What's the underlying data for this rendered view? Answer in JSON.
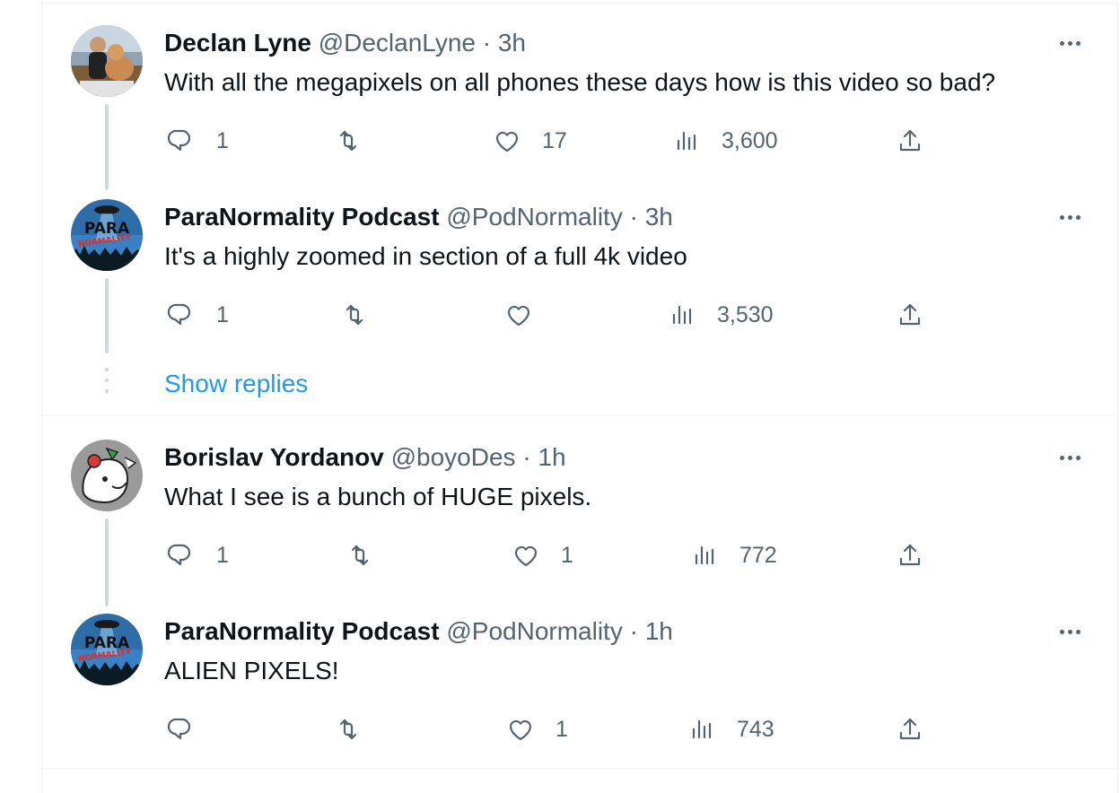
{
  "tweets": [
    {
      "name": "Declan Lyne",
      "handle": "@DeclanLyne",
      "sep": "·",
      "time": "3h",
      "text": "With all the megapixels on all phones these days how is this video so bad?",
      "replies": "1",
      "retweets": "",
      "likes": "17",
      "views": "3,600",
      "avatar": "person-with-dog-photo"
    },
    {
      "name": "ParaNormality Podcast",
      "handle": "@PodNormality",
      "sep": "·",
      "time": "3h",
      "text": "It's a highly zoomed in section of a full 4k video",
      "replies": "1",
      "retweets": "",
      "likes": "",
      "views": "3,530",
      "avatar": "paranormality-logo"
    },
    {
      "name": "Borislav Yordanov",
      "handle": "@boyoDes",
      "sep": "·",
      "time": "1h",
      "text": "What I see is a bunch of HUGE pixels.",
      "replies": "1",
      "retweets": "",
      "likes": "1",
      "views": "772",
      "avatar": "cartoon-illustration"
    },
    {
      "name": "ParaNormality Podcast",
      "handle": "@PodNormality",
      "sep": "·",
      "time": "1h",
      "text": "ALIEN PIXELS!",
      "replies": "",
      "retweets": "",
      "likes": "1",
      "views": "743",
      "avatar": "paranormality-logo"
    }
  ],
  "show_replies": "Show replies",
  "logo_text": {
    "para": "PARA",
    "normality": "NORMALITY"
  },
  "colors": {
    "link": "#1d9bf0",
    "secondary": "#536471",
    "primary": "#0f1419",
    "line": "#cfd9de"
  },
  "icons": [
    "reply-icon",
    "retweet-icon",
    "like-icon",
    "views-icon",
    "share-icon",
    "more-icon"
  ]
}
